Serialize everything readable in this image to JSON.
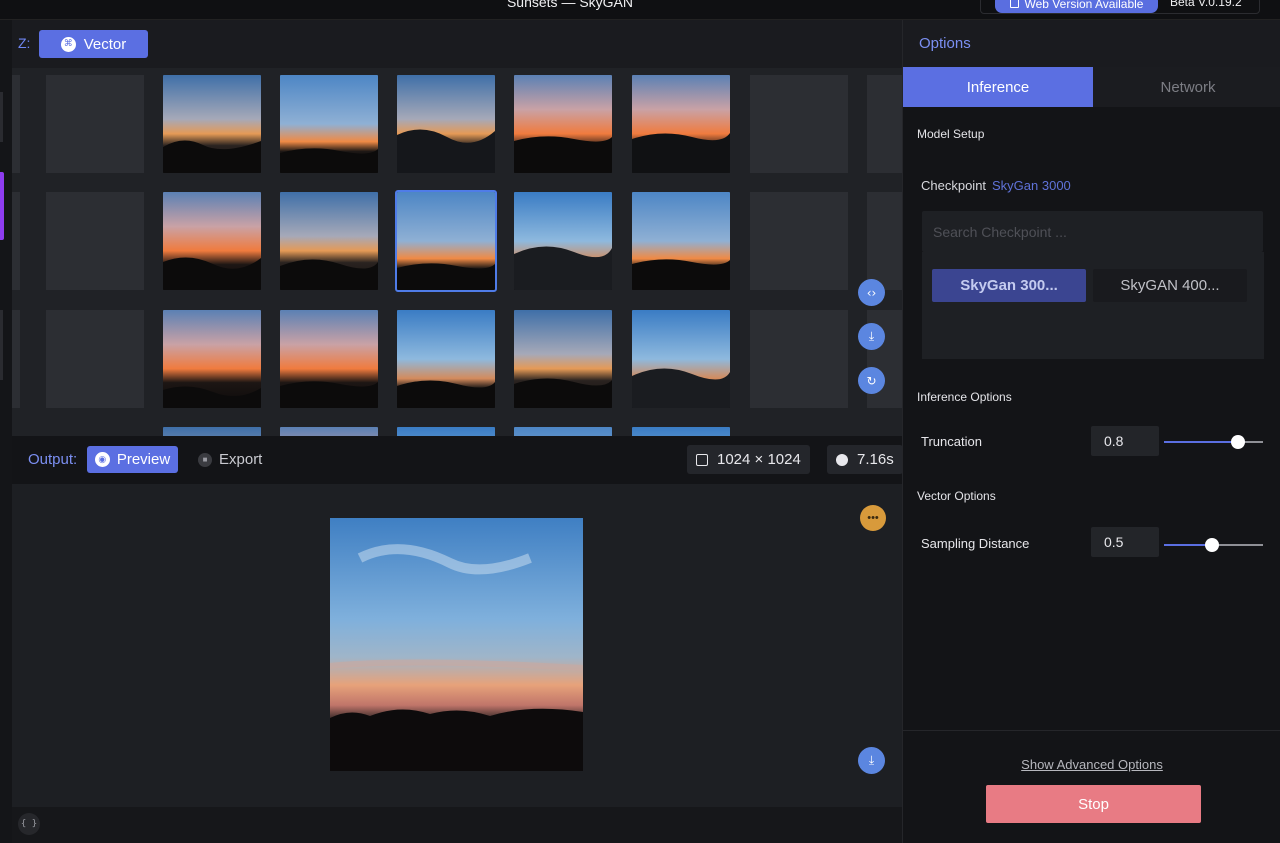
{
  "window": {
    "title": "Sunsets — SkyGAN",
    "web_version": "Web Version Available",
    "version": "Beta V.0.19.2"
  },
  "zbar": {
    "label": "Z:",
    "mode_button": "Vector",
    "mode_icon": "vector-icon"
  },
  "grid": {
    "selected": {
      "row": 1,
      "col": 3
    }
  },
  "side_actions": [
    "code-icon",
    "download-icon",
    "refresh-icon"
  ],
  "output": {
    "label": "Output:",
    "preview_label": "Preview",
    "export_label": "Export",
    "resolution": "1024 × 1024",
    "time": "7.16s"
  },
  "options": {
    "title": "Options",
    "tabs": [
      {
        "label": "Inference",
        "active": true
      },
      {
        "label": "Network",
        "active": false
      }
    ],
    "model_setup": {
      "title": "Model Setup",
      "checkpoint_label": "Checkpoint",
      "checkpoint_value": "SkyGan 3000",
      "search_placeholder": "Search Checkpoint ...",
      "checkpoints": [
        {
          "label": "SkyGan 300...",
          "active": true
        },
        {
          "label": "SkyGAN 400...",
          "active": false
        }
      ]
    },
    "inference": {
      "title": "Inference Options",
      "truncation_label": "Truncation",
      "truncation_value": "0.8",
      "truncation_fraction": 0.75
    },
    "vector": {
      "title": "Vector Options",
      "sampling_label": "Sampling Distance",
      "sampling_value": "0.5",
      "sampling_fraction": 0.48
    },
    "advanced_link": "Show Advanced Options",
    "stop_button": "Stop"
  },
  "colors": {
    "accent": "#5b6fe2",
    "stop": "#e87b84",
    "comment": "#d89a3b"
  }
}
